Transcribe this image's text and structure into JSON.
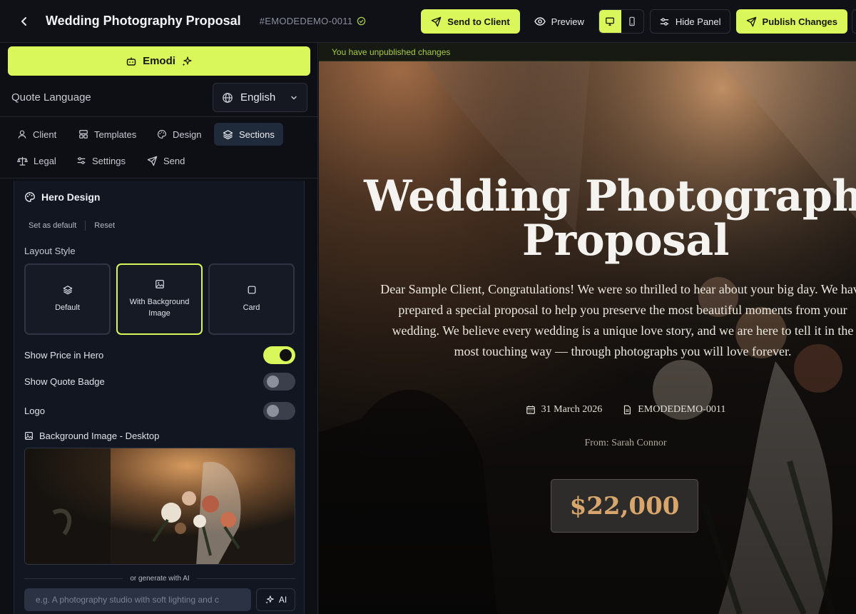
{
  "header": {
    "title": "Wedding Photography Proposal",
    "doc_id": "#EMODEDEMO-0011",
    "send_label": "Send to Client",
    "preview_label": "Preview",
    "hide_panel_label": "Hide Panel",
    "publish_label": "Publish Changes"
  },
  "sidebar": {
    "emodi_label": "Emodi",
    "quote_language_label": "Quote Language",
    "language_value": "English",
    "tabs": [
      {
        "label": "Client",
        "icon": "user-icon"
      },
      {
        "label": "Templates",
        "icon": "layout-icon"
      },
      {
        "label": "Design",
        "icon": "palette-icon"
      },
      {
        "label": "Sections",
        "icon": "layers-icon",
        "active": true
      },
      {
        "label": "Legal",
        "icon": "scale-icon"
      },
      {
        "label": "Settings",
        "icon": "sliders-icon"
      },
      {
        "label": "Send",
        "icon": "send-icon"
      }
    ],
    "hero_design": {
      "title": "Hero Design",
      "set_default_label": "Set as default",
      "reset_label": "Reset",
      "layout_style_label": "Layout Style",
      "layouts": [
        {
          "label": "Default",
          "icon": "layers-icon"
        },
        {
          "label": "With Background Image",
          "icon": "image-icon",
          "selected": true
        },
        {
          "label": "Card",
          "icon": "square-icon"
        }
      ],
      "toggles": [
        {
          "label": "Show Price in Hero",
          "on": true
        },
        {
          "label": "Show Quote Badge",
          "on": false
        },
        {
          "label": "Logo",
          "on": false
        }
      ],
      "bg_image_label": "Background Image - Desktop",
      "generate_label": "or generate with AI",
      "ai_placeholder": "e.g. A photography studio with soft lighting and c",
      "ai_button_label": "AI"
    }
  },
  "preview": {
    "unpublished_notice": "You have unpublished changes",
    "hero_title": "Wedding Photography\nProposal",
    "intro": "Dear Sample Client, Congratulations! We were so thrilled to hear about your big day. We have prepared a special proposal to help you preserve the most beautiful moments from your wedding. We believe every wedding is a unique love story, and we are here to tell it in the most touching way — through photographs you will love forever.",
    "date": "31 March 2026",
    "quote_id": "EMODEDEMO-0011",
    "from": "From: Sarah Connor",
    "price": "$22,000"
  },
  "colors": {
    "accent": "#d9f65a",
    "panel_bg": "#0d0f14",
    "price_gold": "#d8a66c"
  }
}
